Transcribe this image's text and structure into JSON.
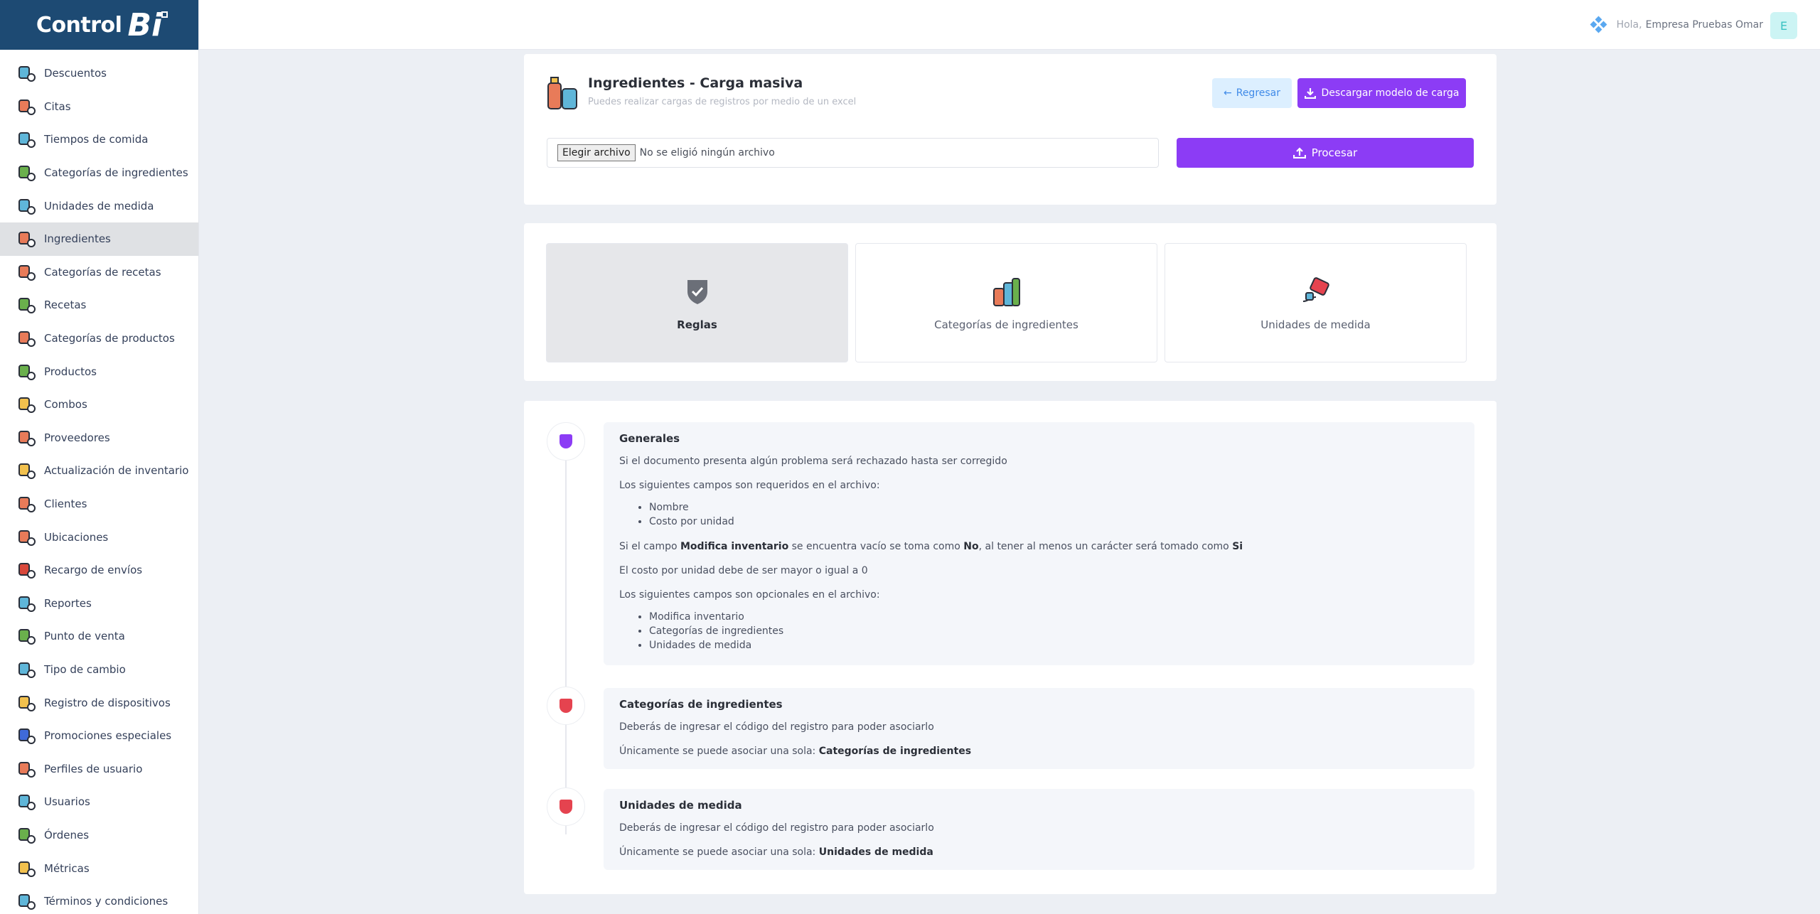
{
  "brand": {
    "text": "Control",
    "mark": "Bi"
  },
  "sidebar": {
    "items": [
      {
        "label": "Descuentos",
        "icon": "discount-icon",
        "c": "#5fb6d9"
      },
      {
        "label": "Citas",
        "icon": "calendar-icon",
        "c": "#e87b59"
      },
      {
        "label": "Tiempos de comida",
        "icon": "meal-time-icon",
        "c": "#5fb6d9"
      },
      {
        "label": "Categorías de ingredientes",
        "icon": "ingredient-categories-icon",
        "c": "#6ab04c"
      },
      {
        "label": "Unidades de medida",
        "icon": "measure-units-icon",
        "c": "#5fb6d9"
      },
      {
        "label": "Ingredientes",
        "icon": "ingredients-icon",
        "c": "#e87b59",
        "active": true
      },
      {
        "label": "Categorías de recetas",
        "icon": "recipe-categories-icon",
        "c": "#e87b59"
      },
      {
        "label": "Recetas",
        "icon": "recipes-icon",
        "c": "#6ab04c"
      },
      {
        "label": "Categorías de productos",
        "icon": "product-categories-icon",
        "c": "#e87b59"
      },
      {
        "label": "Productos",
        "icon": "products-icon",
        "c": "#6ab04c"
      },
      {
        "label": "Combos",
        "icon": "combos-icon",
        "c": "#f2c14e"
      },
      {
        "label": "Proveedores",
        "icon": "suppliers-icon",
        "c": "#e87b59"
      },
      {
        "label": "Actualización de inventario",
        "icon": "inventory-update-icon",
        "c": "#f2c14e"
      },
      {
        "label": "Clientes",
        "icon": "clients-icon",
        "c": "#e87b59"
      },
      {
        "label": "Ubicaciones",
        "icon": "locations-icon",
        "c": "#e87b59"
      },
      {
        "label": "Recargo de envíos",
        "icon": "shipping-fee-icon",
        "c": "#d9483b"
      },
      {
        "label": "Reportes",
        "icon": "reports-icon",
        "c": "#5fb6d9"
      },
      {
        "label": "Punto de venta",
        "icon": "point-of-sale-icon",
        "c": "#6ab04c"
      },
      {
        "label": "Tipo de cambio",
        "icon": "exchange-rate-icon",
        "c": "#5fb6d9"
      },
      {
        "label": "Registro de dispositivos",
        "icon": "devices-icon",
        "c": "#f2c14e"
      },
      {
        "label": "Promociones especiales",
        "icon": "promotions-icon",
        "c": "#3f6ad9"
      },
      {
        "label": "Perfiles de usuario",
        "icon": "user-profiles-icon",
        "c": "#e87b59"
      },
      {
        "label": "Usuarios",
        "icon": "users-icon",
        "c": "#5fb6d9"
      },
      {
        "label": "Órdenes",
        "icon": "orders-icon",
        "c": "#6ab04c"
      },
      {
        "label": "Métricas",
        "icon": "metrics-icon",
        "c": "#f2c14e"
      },
      {
        "label": "Términos y condiciones",
        "icon": "terms-icon",
        "c": "#5fb6d9"
      }
    ]
  },
  "header": {
    "greeting": "Hola,",
    "user": "Empresa Pruebas Omar",
    "avatar": "E"
  },
  "upload": {
    "title": "Ingredientes - Carga masiva",
    "subtitle": "Puedes realizar cargas de registros por medio de un excel",
    "back_label": "Regresar",
    "download_label": "Descargar modelo de carga",
    "file_button": "Elegir archivo",
    "file_status": "No se eligió ningún archivo",
    "process_label": "Procesar"
  },
  "tabs": [
    {
      "label": "Reglas",
      "active": true
    },
    {
      "label": "Categorías de ingredientes"
    },
    {
      "label": "Unidades de medida"
    }
  ],
  "rules": {
    "general": {
      "title": "Generales",
      "p1": "Si el documento presenta algún problema será rechazado hasta ser corregido",
      "p2": "Los siguientes campos son requeridos en el archivo:",
      "required": [
        "Nombre",
        "Costo por unidad"
      ],
      "p3_a": "Si el campo ",
      "p3_b": "Modifica inventario",
      "p3_c": " se encuentra vacío se toma como ",
      "p3_d": "No",
      "p3_e": ", al tener al menos un carácter será tomado como ",
      "p3_f": "Si",
      "p4": "El costo por unidad debe de ser mayor o igual a 0",
      "p5": "Los siguientes campos son opcionales en el archivo:",
      "optional": [
        "Modifica inventario",
        "Categorías de ingredientes",
        "Unidades de medida"
      ]
    },
    "categories": {
      "title": "Categorías de ingredientes",
      "p1": "Deberás de ingresar el código del registro para poder asociarlo",
      "p2": "Únicamente se puede asociar una sola: ",
      "p2_b": "Categorías de ingredientes"
    },
    "units": {
      "title": "Unidades de medida",
      "p1": "Deberás de ingresar el código del registro para poder asociarlo",
      "p2": "Únicamente se puede asociar una sola: ",
      "p2_b": "Unidades de medida"
    }
  },
  "colors": {
    "accent": "#8c3cf5",
    "brand": "#1d4a73",
    "back_bg": "#dcefff",
    "shield_general": "#8c3cf5",
    "shield_other": "#e5434f"
  }
}
